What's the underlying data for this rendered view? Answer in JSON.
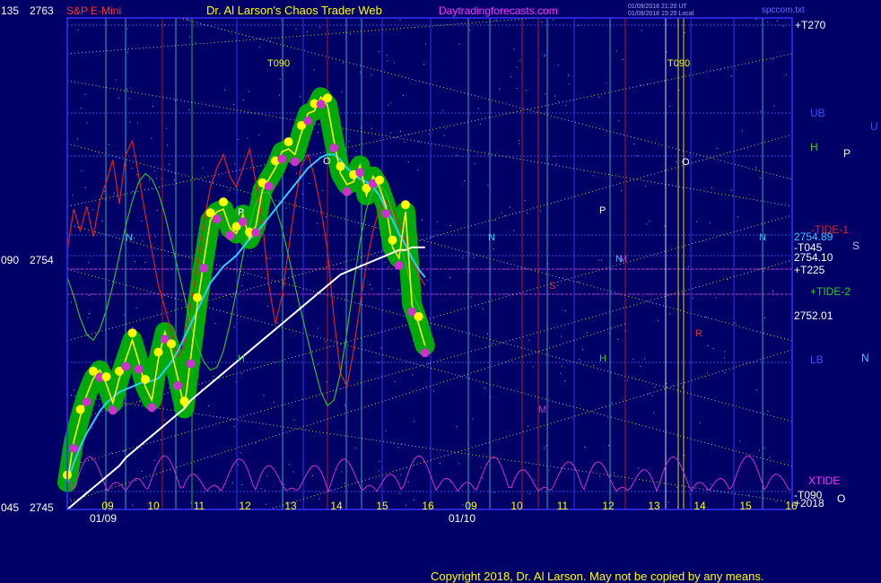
{
  "header": {
    "symbol": "S&P E-Mini",
    "author": "Dr. Al Larson's Chaos Trader Web",
    "site": "Daytradingforecasts.com",
    "stamp_1": "01/09/2018 21:20 UT",
    "stamp_2": "01/09/2018 15:20 Local",
    "file": "spccom.txt"
  },
  "footer": {
    "copyright": "Copyright 2018, Dr. Al Larson. May not be copied by any means."
  },
  "colors": {
    "background": "#000066",
    "plot_border": "#3333ff",
    "price": "#ffff00",
    "price_avg": "#ff33ff",
    "ema_fast": "#33ccff",
    "ema_slow": "#ffffff",
    "tide_red": "#dd2222",
    "tide_green": "#33bb33",
    "xtide": "#cc33cc",
    "halo": "#00bb00",
    "dot_high": "#ffff00",
    "dot_low": "#cc33cc"
  },
  "chart_data": {
    "type": "line",
    "title": "S&P E-Mini",
    "y_axis": {
      "ylim": [
        2745,
        2763
      ],
      "ticks": [
        {
          "left": "135",
          "value": "2763"
        },
        {
          "left": "090",
          "value": "2754"
        },
        {
          "left": "045",
          "value": "2745"
        }
      ]
    },
    "x_axis": {
      "sessions": [
        {
          "date": "01/09",
          "hours": [
            "09",
            "10",
            "11",
            "12",
            "13",
            "14",
            "15",
            "16"
          ]
        },
        {
          "date": "01/10",
          "hours": [
            "09",
            "10",
            "11",
            "12",
            "13",
            "14",
            "15",
            "16"
          ]
        }
      ]
    },
    "last_prices": {
      "upper": "2754.89",
      "mid": "2754.10",
      "lower": "2752.01"
    },
    "right_labels": [
      {
        "text": "+T270",
        "color": "#ffffff"
      },
      {
        "text": "UB",
        "color": "#3355ff"
      },
      {
        "text": "U",
        "color": "#3355ff"
      },
      {
        "text": "H",
        "color": "#33cc33"
      },
      {
        "text": "P",
        "color": "#ffffff"
      },
      {
        "text": "-TIDE-1",
        "color": "#dd2222"
      },
      {
        "text": "-T045",
        "color": "#ffffff"
      },
      {
        "text": "S",
        "color": "#bbbbff"
      },
      {
        "text": "+T225",
        "color": "#ffffff"
      },
      {
        "text": "+TIDE-2",
        "color": "#33cc33"
      },
      {
        "text": "LB",
        "color": "#3355ff"
      },
      {
        "text": "N",
        "color": "#33ccff"
      },
      {
        "text": "XTIDE",
        "color": "#ff33ff"
      },
      {
        "text": "-T090",
        "color": "#ffffff"
      },
      {
        "text": "+2018",
        "color": "#ffffff"
      },
      {
        "text": "O",
        "color": "#ffffff"
      }
    ],
    "top_labels": [
      "T090",
      "T090"
    ],
    "in_plot_letters": [
      {
        "text": "N",
        "color": "#33ccff"
      },
      {
        "text": "P",
        "color": "#ffffff"
      },
      {
        "text": "H",
        "color": "#33cc33"
      },
      {
        "text": "O",
        "color": "#ffffff"
      },
      {
        "text": "N",
        "color": "#33ccff"
      },
      {
        "text": "P",
        "color": "#ffffff"
      },
      {
        "text": "S",
        "color": "#dd3333"
      },
      {
        "text": "M",
        "color": "#cc33cc"
      },
      {
        "text": "H",
        "color": "#33cc33"
      },
      {
        "text": "O",
        "color": "#ffffff"
      },
      {
        "text": "N",
        "color": "#33ccff"
      },
      {
        "text": "M",
        "color": "#cc33cc"
      },
      {
        "text": "R",
        "color": "#dd3333"
      },
      {
        "text": "N",
        "color": "#33ccff"
      }
    ],
    "series": [
      {
        "name": "price",
        "values": [
          2746.0,
          2747.5,
          2748.4,
          2749.2,
          2749.8,
          2750.1,
          2749.6,
          2748.9,
          2749.8,
          2750.5,
          2751.2,
          2750.4,
          2749.5,
          2749.0,
          2750.5,
          2751.5,
          2750.8,
          2749.8,
          2748.7,
          2750.6,
          2752.5,
          2754.1,
          2755.6,
          2755.9,
          2756.0,
          2755.3,
          2755.1,
          2755.8,
          2754.9,
          2755.4,
          2756.7,
          2757.1,
          2757.5,
          2758.1,
          2758.2,
          2758.0,
          2758.8,
          2759.5,
          2759.6,
          2760.1,
          2759.8,
          2758.5,
          2757.3,
          2756.9,
          2757.0,
          2757.6,
          2756.5,
          2757.2,
          2756.8,
          2756.1,
          2754.6,
          2754.2,
          2755.9,
          2752.5,
          2751.8,
          2751.0
        ]
      },
      {
        "name": "ema_fast",
        "values": [
          2746.0,
          2746.7,
          2747.3,
          2747.8,
          2748.2,
          2748.6,
          2748.9,
          2749.1,
          2749.3,
          2749.4,
          2749.5,
          2749.6,
          2749.7,
          2749.7,
          2749.8,
          2750.1,
          2750.4,
          2750.8,
          2751.3,
          2751.8,
          2752.3,
          2752.8,
          2753.3,
          2753.6,
          2753.9,
          2754.1,
          2754.3,
          2754.6,
          2754.9,
          2755.1,
          2755.4,
          2755.7,
          2756.0,
          2756.3,
          2756.6,
          2756.9,
          2757.2,
          2757.5,
          2757.7,
          2757.9,
          2758.0,
          2758.0,
          2757.8,
          2757.5,
          2757.3,
          2757.1,
          2757.0,
          2756.8,
          2756.5,
          2756.0,
          2755.6,
          2755.1,
          2754.7,
          2754.2,
          2753.8,
          2753.5
        ]
      },
      {
        "name": "ema_slow",
        "values": [
          2745.0,
          2745.2,
          2745.4,
          2745.6,
          2745.8,
          2746.0,
          2746.2,
          2746.4,
          2746.6,
          2746.9,
          2747.1,
          2747.3,
          2747.5,
          2747.7,
          2747.9,
          2748.1,
          2748.3,
          2748.5,
          2748.7,
          2749.0,
          2749.2,
          2749.4,
          2749.6,
          2749.8,
          2750.0,
          2750.2,
          2750.4,
          2750.6,
          2750.8,
          2751.0,
          2751.2,
          2751.4,
          2751.6,
          2751.8,
          2752.0,
          2752.2,
          2752.4,
          2752.6,
          2752.8,
          2753.0,
          2753.2,
          2753.4,
          2753.6,
          2753.7,
          2753.8,
          2753.9,
          2754.0,
          2754.1,
          2754.2,
          2754.3,
          2754.4,
          2754.5,
          2754.5,
          2754.6,
          2754.6,
          2754.6
        ]
      },
      {
        "name": "TIDE-1",
        "values": [
          2754.5,
          2756.0,
          2755.2,
          2756.1,
          2755.0,
          2756.3,
          2757.0,
          2757.8,
          2756.2,
          2758.0,
          2758.5,
          2757.2,
          2755.8,
          2754.5,
          2753.2,
          2752.4,
          2751.5,
          2750.6,
          2751.0,
          2752.5,
          2754.0,
          2755.5,
          2756.8,
          2757.5,
          2758.0,
          2757.2,
          2756.8,
          2757.5,
          2758.2,
          2757.0,
          2755.5,
          2753.2,
          2751.8,
          2752.8,
          2754.5,
          2756.2,
          2757.6,
          2758.0,
          2757.2,
          2756.0,
          2754.5,
          2752.0,
          2750.0,
          2749.5,
          2750.8,
          2752.5,
          2754.0,
          2755.2,
          2756.0,
          2756.3,
          2756.0,
          2755.5,
          2754.8,
          2754.2,
          2753.6,
          2753.2
        ]
      },
      {
        "name": "TIDE-2",
        "values": [
          2753.5,
          2752.8,
          2752.0,
          2751.4,
          2751.2,
          2751.6,
          2752.3,
          2753.2,
          2754.3,
          2755.4,
          2756.3,
          2757.0,
          2757.3,
          2757.1,
          2756.6,
          2755.8,
          2754.8,
          2753.8,
          2752.8,
          2751.8,
          2751.0,
          2750.4,
          2750.1,
          2750.2,
          2750.8,
          2751.8,
          2753.0,
          2754.3,
          2755.4,
          2756.2,
          2756.6,
          2756.6,
          2756.1,
          2755.3,
          2754.3,
          2753.2,
          2752.2,
          2751.2,
          2750.2,
          2749.3,
          2748.8,
          2749.0,
          2750.0,
          2751.5,
          2753.2,
          2754.8,
          2756.0,
          2756.7,
          2756.9,
          2756.6,
          2755.9,
          2755.0,
          2754.0,
          2753.0,
          2752.4,
          2752.0
        ]
      }
    ]
  }
}
